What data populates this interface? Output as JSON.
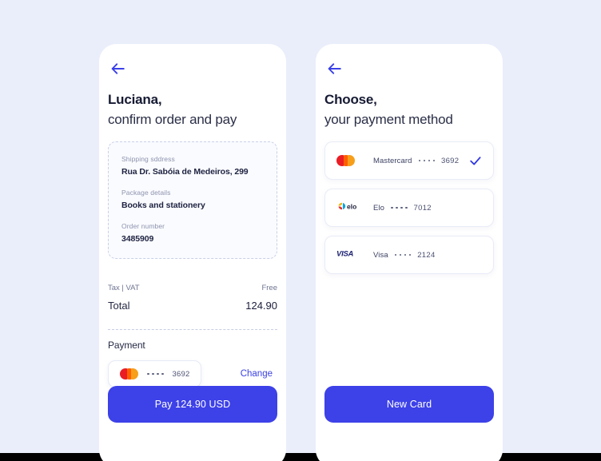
{
  "theme": {
    "background": "#eaeefb",
    "panel": "#ffffff",
    "accent": "#3d41e8",
    "text_dark": "#161a33",
    "text_muted": "#8d93ad",
    "mastercard_red": "#ea1d25",
    "mastercard_yellow": "#f79e1b",
    "elo_yellow": "#efb917",
    "elo_red": "#e4322b",
    "elo_blue": "#00a4e0",
    "visa_blue": "#1a1f71"
  },
  "left_screen": {
    "back_icon": "arrow-left-icon",
    "heading_line1": "Luciana,",
    "heading_line2": "confirm order and pay",
    "details": [
      {
        "label": "Shipping sddress",
        "value": "Rua Dr. Sabóia de Medeiros, 299"
      },
      {
        "label": "Package details",
        "value": "Books and stationery"
      },
      {
        "label": "Order number",
        "value": "3485909"
      }
    ],
    "totals": {
      "tax_label": "Tax | VAT",
      "tax_value": "Free",
      "total_label": "Total",
      "total_value": "124.90"
    },
    "payment": {
      "section_title": "Payment",
      "card_brand": "mastercard-logo",
      "card_digits": "3692",
      "change_label": "Change"
    },
    "primary_button": "Pay 124.90 USD"
  },
  "right_screen": {
    "back_icon": "arrow-left-icon",
    "heading_line1": "Choose,",
    "heading_line2": "your payment method",
    "methods": [
      {
        "brand_icon": "mastercard-logo",
        "name": "Mastercard",
        "digits": "3692",
        "selected": true
      },
      {
        "brand_icon": "elo-logo",
        "name": "Elo",
        "digits": "7012",
        "selected": false
      },
      {
        "brand_icon": "visa-logo",
        "name": "Visa",
        "digits": "2124",
        "selected": false
      }
    ],
    "primary_button": "New Card"
  }
}
